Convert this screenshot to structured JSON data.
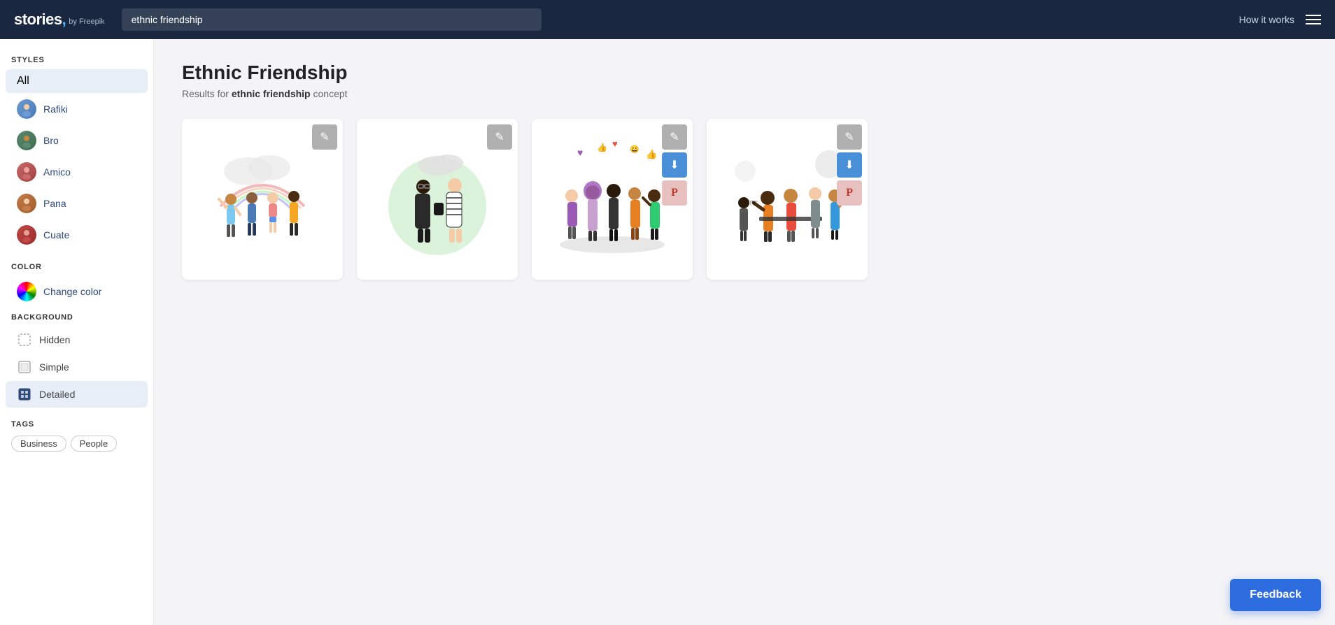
{
  "header": {
    "logo_text": "stories",
    "logo_sub": "by Freepik",
    "search_placeholder": "ethnic friendship",
    "search_value": "ethnic friendship",
    "how_it_works": "How it works"
  },
  "sidebar": {
    "styles_title": "STYLES",
    "styles": [
      {
        "id": "all",
        "label": "All",
        "active": true,
        "has_avatar": false
      },
      {
        "id": "rafiki",
        "label": "Rafiki",
        "active": false,
        "has_avatar": true,
        "avatar_class": "avatar-rafiki"
      },
      {
        "id": "bro",
        "label": "Bro",
        "active": false,
        "has_avatar": true,
        "avatar_class": "avatar-bro"
      },
      {
        "id": "amico",
        "label": "Amico",
        "active": false,
        "has_avatar": true,
        "avatar_class": "avatar-amico"
      },
      {
        "id": "pana",
        "label": "Pana",
        "active": false,
        "has_avatar": true,
        "avatar_class": "avatar-pana"
      },
      {
        "id": "cuate",
        "label": "Cuate",
        "active": false,
        "has_avatar": true,
        "avatar_class": "avatar-cuate"
      }
    ],
    "color_title": "COLOR",
    "color_change_label": "Change color",
    "background_title": "BACKGROUND",
    "backgrounds": [
      {
        "id": "hidden",
        "label": "Hidden",
        "active": false
      },
      {
        "id": "simple",
        "label": "Simple",
        "active": false
      },
      {
        "id": "detailed",
        "label": "Detailed",
        "active": true
      }
    ],
    "tags_title": "TAGS",
    "tags": [
      {
        "id": "business",
        "label": "Business"
      },
      {
        "id": "people",
        "label": "People"
      }
    ]
  },
  "content": {
    "title": "Ethnic Friendship",
    "subtitle_prefix": "Results for ",
    "subtitle_keyword": "ethnic friendship",
    "subtitle_suffix": " concept"
  },
  "illustrations": [
    {
      "id": "illus-1",
      "actions": [
        "edit"
      ],
      "description": "Group of diverse friends standing together with rainbow",
      "has_edit": true,
      "has_download": false,
      "has_pinterest": false
    },
    {
      "id": "illus-2",
      "actions": [
        "edit"
      ],
      "description": "Two women talking with green circle background",
      "has_edit": true,
      "has_download": false,
      "has_pinterest": false
    },
    {
      "id": "illus-3",
      "actions": [
        "edit",
        "download",
        "pinterest"
      ],
      "description": "Group of diverse women with heart emojis floating",
      "has_edit": true,
      "has_download": true,
      "has_pinterest": true
    },
    {
      "id": "illus-4",
      "actions": [
        "edit",
        "download",
        "pinterest"
      ],
      "description": "Group of friends watching something together",
      "has_edit": true,
      "has_download": true,
      "has_pinterest": true
    }
  ],
  "feedback": {
    "label": "Feedback"
  },
  "icons": {
    "edit": "✎",
    "download": "⬇",
    "pinterest": "P",
    "menu": "☰",
    "hidden_bg": "◻",
    "simple_bg": "◻",
    "detailed_bg": "◼"
  }
}
